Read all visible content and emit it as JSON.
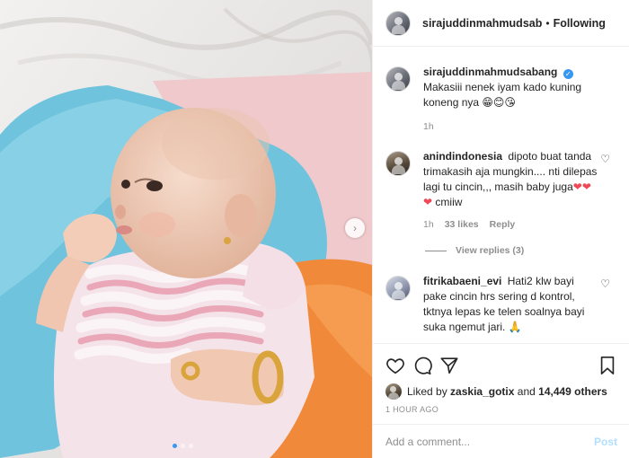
{
  "post": {
    "author": "sirajuddinmahmudsab",
    "follow_status": "Following",
    "separator": "•"
  },
  "caption": {
    "username": "sirajuddinmahmudsabang",
    "text": "Makasiii nenek iyam kado kuning koneng nya",
    "emoji": "😁😊😘",
    "time": "1h"
  },
  "comments": [
    {
      "username": "anindindonesia",
      "text": "dipoto buat tanda trimakasih aja mungkin.... nti dilepas lagi tu cincin,,, masih baby juga",
      "hearts": "❤❤❤",
      "suffix": "cmiiw",
      "time": "1h",
      "likes": "33 likes",
      "reply": "Reply",
      "view_replies": "View replies (3)"
    },
    {
      "username": "fitrikabaeni_evi",
      "text": "Hati2 klw bayi pake cincin hrs sering d kontrol, tktnya lepas ke telen soalnya bayi suka ngemut jari.",
      "emoji": "🙏"
    }
  ],
  "likes": {
    "prefix": "Liked by",
    "user": "zaskia_gotix",
    "conjunction": "and",
    "count": "14,449 others"
  },
  "timestamp": "1 HOUR AGO",
  "add_comment": {
    "placeholder": "Add a comment...",
    "post_label": "Post"
  },
  "carousel": {
    "slide_count": 3,
    "active_index": 0
  },
  "colors": {
    "accent": "#3897f0",
    "heart": "#ed4956",
    "muted": "#8e8e8e",
    "post_disabled": "#b2dffc"
  }
}
